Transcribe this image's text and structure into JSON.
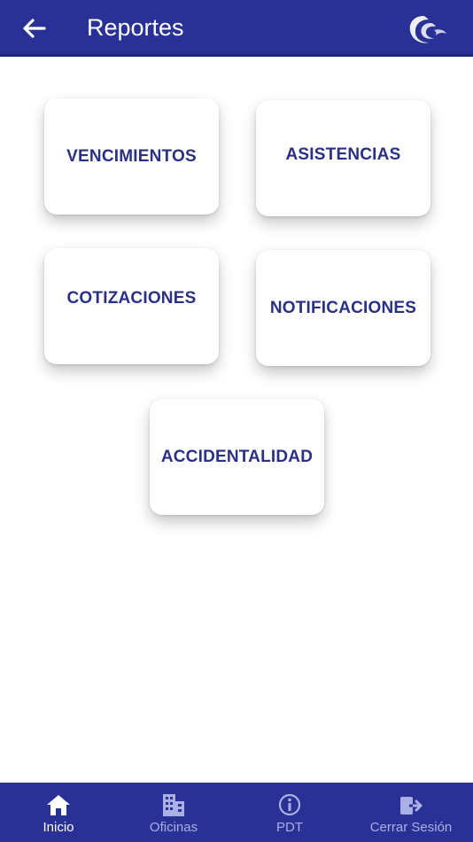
{
  "header": {
    "title": "Reportes",
    "back_icon": "arrow-left-icon",
    "logo_icon": "swirl-logo"
  },
  "reports": [
    {
      "label": "VENCIMIENTOS"
    },
    {
      "label": "ASISTENCIAS"
    },
    {
      "label": "COTIZACIONES"
    },
    {
      "label": "NOTIFICACIONES"
    },
    {
      "label": "ACCIDENTALIDAD"
    }
  ],
  "bottom_nav": {
    "items": [
      {
        "label": "Inicio",
        "icon": "home-icon",
        "active": true
      },
      {
        "label": "Oficinas",
        "icon": "building-icon",
        "active": false
      },
      {
        "label": "PDT",
        "icon": "info-icon",
        "active": false
      },
      {
        "label": "Cerrar Sesión",
        "icon": "logout-icon",
        "active": false
      }
    ]
  },
  "colors": {
    "primary": "#2a3196",
    "card_text": "#2a3084",
    "nav_inactive": "#aab0e3"
  }
}
